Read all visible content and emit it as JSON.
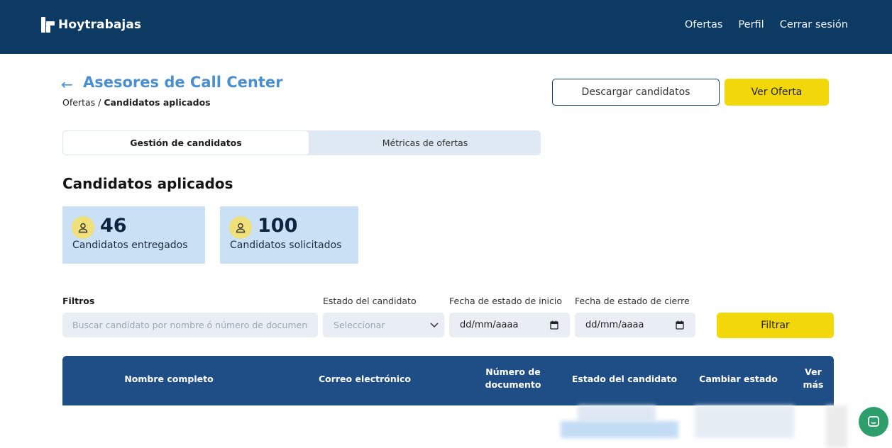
{
  "header": {
    "brand": "Hoytrabajas",
    "nav": [
      "Ofertas",
      "Perfil",
      "Cerrar sesión"
    ]
  },
  "page": {
    "title": "Asesores de Call Center",
    "breadcrumb": {
      "parent": "Ofertas",
      "separator": "/",
      "current": "Candidatos aplicados"
    },
    "download_button": "Descargar candidatos",
    "view_offer_button": "Ver Oferta"
  },
  "tabs": [
    {
      "label": "Gestión de candidatos",
      "active": true
    },
    {
      "label": "Métricas de ofertas",
      "active": false
    }
  ],
  "section_title": "Candidatos aplicados",
  "stats": [
    {
      "value": "46",
      "label": "Candidatos entregados"
    },
    {
      "value": "100",
      "label": "Candidatos solicitados"
    }
  ],
  "filters": {
    "title": "Filtros",
    "search_placeholder": "Buscar candidato por nombre ó número de documento",
    "status_label": "Estado del candidato",
    "status_value": "Seleccionar",
    "start_label": "Fecha de estado de inicio",
    "start_value": "dd/mm/aaaa",
    "end_label": "Fecha de estado de cierre",
    "end_value": "dd/mm/aaaa",
    "filter_button": "Filtrar"
  },
  "table": {
    "columns": [
      "Nombre completo",
      "Correo electrónico",
      "Número de documento",
      "Estado del candidato",
      "Cambiar estado",
      "Ver más"
    ]
  },
  "colors": {
    "header_bg": "#0c3a63",
    "accent_blue": "#4a8fd0",
    "accent_yellow": "#f2d80a",
    "table_header": "#1f4e86",
    "stat_card": "#c9e0f5"
  }
}
